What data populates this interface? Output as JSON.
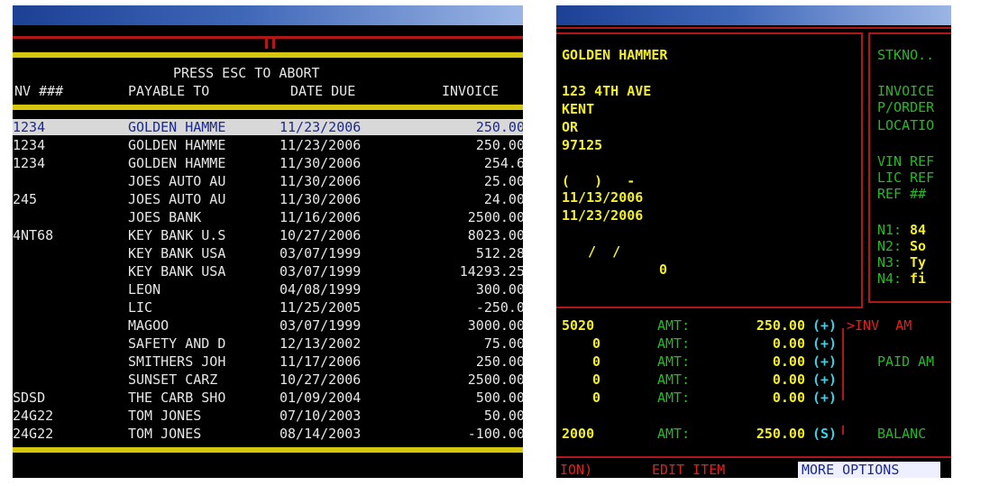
{
  "left": {
    "header": {
      "abort": "PRESS ESC TO ABORT",
      "col_inv": "NV ###",
      "col_payable": "PAYABLE TO",
      "col_date": "DATE DUE",
      "col_invoice": "INVOICE"
    },
    "rows": [
      {
        "inv": "1234",
        "payee": "GOLDEN HAMME",
        "date": "11/23/2006",
        "amt": "250.00"
      },
      {
        "inv": "1234",
        "payee": "GOLDEN HAMME",
        "date": "11/23/2006",
        "amt": "250.00"
      },
      {
        "inv": "1234",
        "payee": "GOLDEN HAMME",
        "date": "11/30/2006",
        "amt": "254.6"
      },
      {
        "inv": "",
        "payee": "JOES AUTO AU",
        "date": "11/30/2006",
        "amt": "25.00"
      },
      {
        "inv": "245",
        "payee": "JOES AUTO AU",
        "date": "11/30/2006",
        "amt": "24.00"
      },
      {
        "inv": "",
        "payee": "JOES BANK",
        "date": "11/16/2006",
        "amt": "2500.00"
      },
      {
        "inv": "4NT68",
        "payee": "KEY BANK U.S",
        "date": "10/27/2006",
        "amt": "8023.00"
      },
      {
        "inv": "",
        "payee": "KEY BANK USA",
        "date": "03/07/1999",
        "amt": "512.28"
      },
      {
        "inv": "",
        "payee": "KEY BANK USA",
        "date": "03/07/1999",
        "amt": "14293.25"
      },
      {
        "inv": "",
        "payee": "LEON",
        "date": "04/08/1999",
        "amt": "300.00"
      },
      {
        "inv": "",
        "payee": "LIC",
        "date": "11/25/2005",
        "amt": "-250.0"
      },
      {
        "inv": "",
        "payee": "MAGOO",
        "date": "03/07/1999",
        "amt": "3000.00"
      },
      {
        "inv": "",
        "payee": "SAFETY AND D",
        "date": "12/13/2002",
        "amt": "75.00"
      },
      {
        "inv": "",
        "payee": "SMITHERS JOH",
        "date": "11/17/2006",
        "amt": "250.00"
      },
      {
        "inv": "",
        "payee": "SUNSET CARZ",
        "date": "10/27/2006",
        "amt": "2500.00"
      },
      {
        "inv": "SDSD",
        "payee": "THE CARB SHO",
        "date": "01/09/2004",
        "amt": "500.00"
      },
      {
        "inv": "24G22",
        "payee": "TOM JONES",
        "date": "07/10/2003",
        "amt": "50.00"
      },
      {
        "inv": "24G22",
        "payee": "TOM JONES",
        "date": "08/14/2003",
        "amt": "-100.00"
      }
    ]
  },
  "right": {
    "vendor": {
      "name": "GOLDEN HAMMER",
      "address": "123 4TH AVE",
      "city": "KENT",
      "state": "OR",
      "zip": "97125",
      "phone": "(   )   -",
      "date1": "11/13/2006",
      "date2": "11/23/2006",
      "date3": " /  /",
      "zero": "0"
    },
    "side_labels": {
      "stkno": "STKNO..",
      "invoice": "INVOICE",
      "porder": "P/ORDER",
      "location": "LOCATIO",
      "vin": "VIN REF",
      "lic": "LIC REF",
      "ref": "REF ##",
      "n1": "N1:",
      "n1v": "84",
      "n2": "N2:",
      "n2v": "So",
      "n3": "N3:",
      "n3v": "Ty",
      "n4": "N4:",
      "n4v": "fi"
    },
    "amounts": [
      {
        "acct": "5020",
        "label": "AMT:",
        "value": "250.00",
        "sign": "(+)"
      },
      {
        "acct": "0",
        "label": "AMT:",
        "value": "0.00",
        "sign": "(+)"
      },
      {
        "acct": "0",
        "label": "AMT:",
        "value": "0.00",
        "sign": "(+)"
      },
      {
        "acct": "0",
        "label": "AMT:",
        "value": "0.00",
        "sign": "(+)"
      },
      {
        "acct": "0",
        "label": "AMT:",
        "value": "0.00",
        "sign": "(+)"
      }
    ],
    "total": {
      "acct": "2000",
      "label": "AMT:",
      "value": "250.00",
      "sign": "(S)"
    },
    "inv_label": ">INV  AM",
    "paid_label": "PAID AM",
    "balance_label": "BALANC",
    "bottom": {
      "option": "ION)",
      "edit": "EDIT ITEM",
      "more": "MORE OPTIONS"
    }
  }
}
